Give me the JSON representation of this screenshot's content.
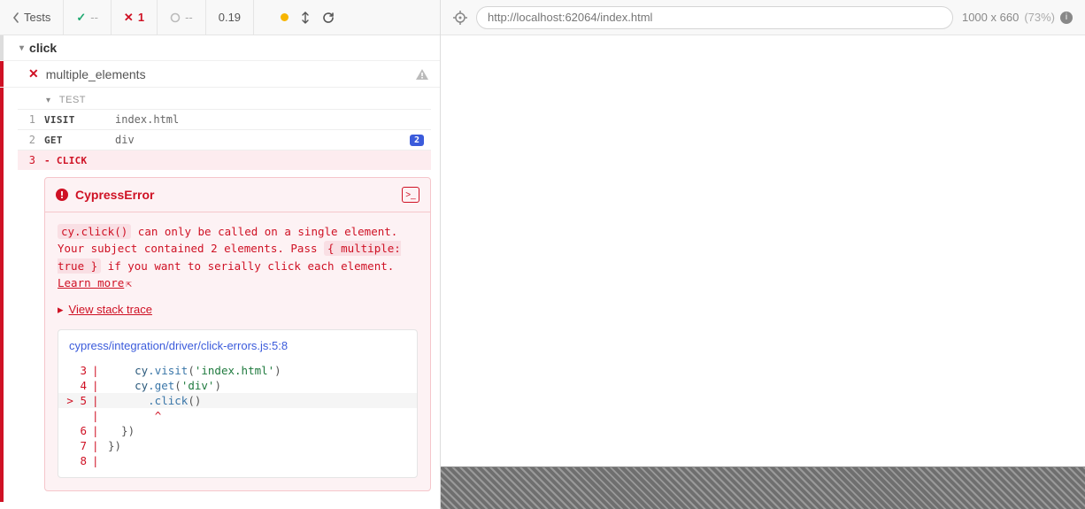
{
  "toolbar": {
    "back_label": "Tests",
    "passed": "--",
    "failed": "1",
    "pending": "--",
    "duration": "0.19"
  },
  "suite": {
    "name": "click"
  },
  "test": {
    "name": "multiple_elements",
    "section_label": "TEST"
  },
  "commands": [
    {
      "num": "1",
      "name": "VISIT",
      "message": "index.html",
      "badge": ""
    },
    {
      "num": "2",
      "name": "GET",
      "message": "div",
      "badge": "2"
    },
    {
      "num": "3",
      "name": "CLICK",
      "message": "",
      "badge": ""
    }
  ],
  "error": {
    "title": "CypressError",
    "msg_pre_code": "cy.click()",
    "msg_mid1": " can only be called on a single element. Your subject contained 2 elements. Pass ",
    "msg_code2": "{ multiple: true }",
    "msg_mid2": " if you want to serially click each element. ",
    "learn_more": "Learn more",
    "stack_label": "View stack trace"
  },
  "codeframe": {
    "path": "cypress/integration/driver/click-errors.js:5:8",
    "lines": {
      "l3_num": "3",
      "l3_code_cy": "cy",
      "l3_code_fn": ".visit",
      "l3_code_p1": "(",
      "l3_code_str": "'index.html'",
      "l3_code_p2": ")",
      "l4_num": "4",
      "l4_code_cy": "cy",
      "l4_code_fn": ".get",
      "l4_code_p1": "(",
      "l4_code_str": "'div'",
      "l4_code_p2": ")",
      "l5_num": "5",
      "l5_caret": ">",
      "l5_code_fn": ".click",
      "l5_code_p": "()",
      "lc_caret": "^",
      "l6_num": "6",
      "l6_code": "  })",
      "l7_num": "7",
      "l7_code": "})",
      "l8_num": "8",
      "l8_code": ""
    }
  },
  "right": {
    "url": "http://localhost:62064/index.html",
    "viewport": "1000 x 660",
    "scale": "(73%)"
  }
}
